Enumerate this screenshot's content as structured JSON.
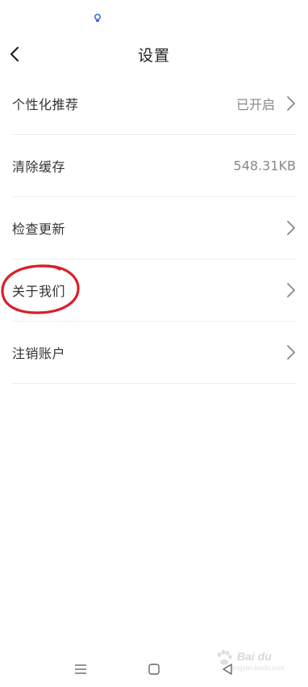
{
  "header": {
    "title": "设置",
    "back_icon": "chevron-left-icon"
  },
  "settings": [
    {
      "label": "个性化推荐",
      "value": "已开启",
      "has_chevron": true
    },
    {
      "label": "清除缓存",
      "value": "548.31KB",
      "has_chevron": false
    },
    {
      "label": "检查更新",
      "value": "",
      "has_chevron": true
    },
    {
      "label": "关于我们",
      "value": "",
      "has_chevron": true,
      "highlighted": true
    },
    {
      "label": "注销账户",
      "value": "",
      "has_chevron": true
    }
  ],
  "nav": {
    "menu_icon": "menu-icon",
    "home_icon": "home-square-icon",
    "back_icon": "back-triangle-icon"
  },
  "watermark": {
    "logo": "Bai du",
    "sub": "jingyan.baidu.com"
  },
  "colors": {
    "text": "#333333",
    "secondary": "#888888",
    "divider": "#eeeeee",
    "annotation": "#d9202a"
  }
}
